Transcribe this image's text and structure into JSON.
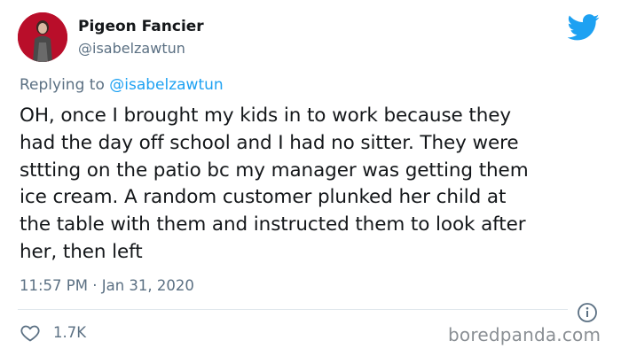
{
  "author": {
    "display_name": "Pigeon Fancier",
    "handle": "@isabelzawtun",
    "avatar_icon": "profile-photo"
  },
  "reply": {
    "prefix": "Replying to ",
    "target": "@isabelzawtun"
  },
  "tweet": {
    "lines": [
      "OH, once I brought my kids in to work because they",
      "had the day off school and I had no sitter. They were",
      "sttting on the patio bc my manager was getting them",
      "ice cream. A random customer plunked her child at",
      "the table with them and instructed them to look after",
      "her, then left"
    ],
    "timestamp": "11:57 PM · Jan 31, 2020",
    "likes": "1.7K"
  },
  "icons": {
    "brand": "twitter-bird-icon",
    "info": "info-icon",
    "like": "heart-icon"
  },
  "colors": {
    "brand_blue": "#1da1f2",
    "text_primary": "#14171a",
    "text_secondary": "#5b7083",
    "avatar_bg": "#c8102e"
  },
  "watermark": "boredpanda.com"
}
